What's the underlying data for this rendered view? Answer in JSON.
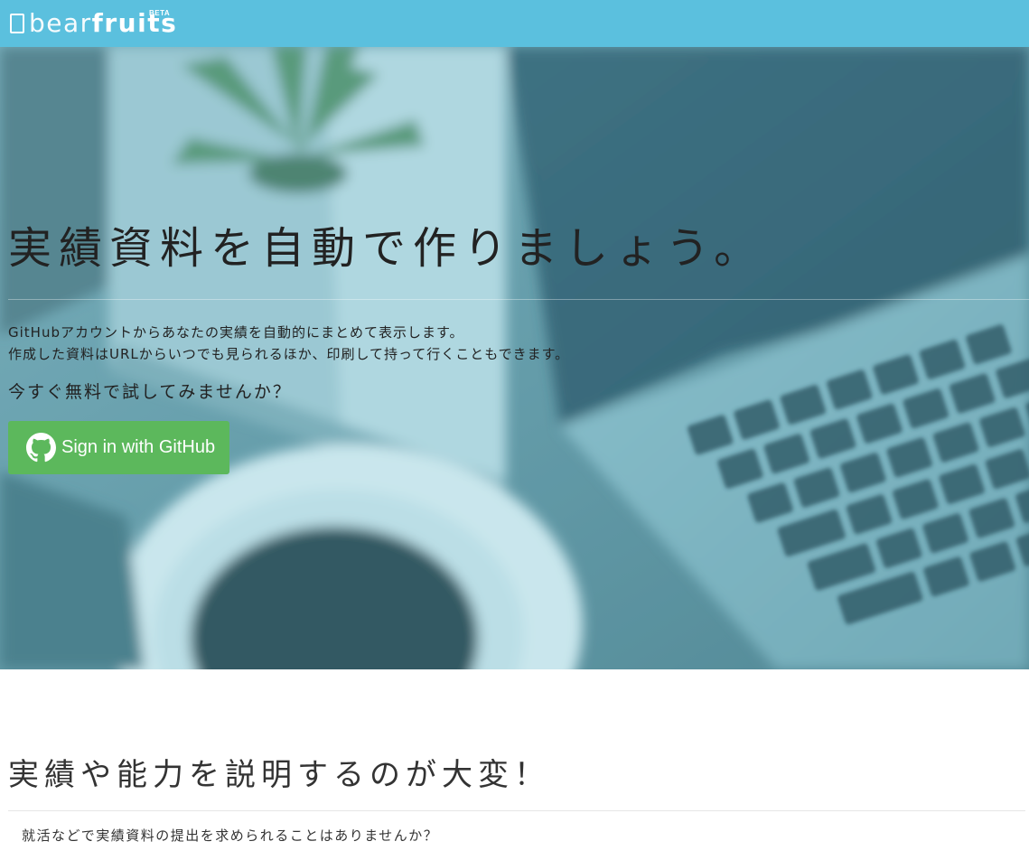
{
  "navbar": {
    "logo_prefix": "bear",
    "logo_suffix": "fruits",
    "logo_badge": "BETA",
    "color": "#5bc0de"
  },
  "hero": {
    "title": "実績資料を自動で作りましょう。",
    "description_lines": [
      "GitHubアカウントからあなたの実績を自動的にまとめて表示します。",
      "作成した資料はURLからいつでも見られるほか、印刷して持って行くこともできます。"
    ],
    "cta_text": "今すぐ無料で試してみませんか？",
    "signin_button": {
      "icon": "github-icon",
      "label": "Sign in with GitHub",
      "color": "#5cb85c"
    },
    "background": "blurred-desk-laptop-coffee-photo"
  },
  "section2": {
    "title": "実績や能力を説明するのが大変！",
    "text": "就活などで実績資料の提出を求められることはありませんか？"
  }
}
